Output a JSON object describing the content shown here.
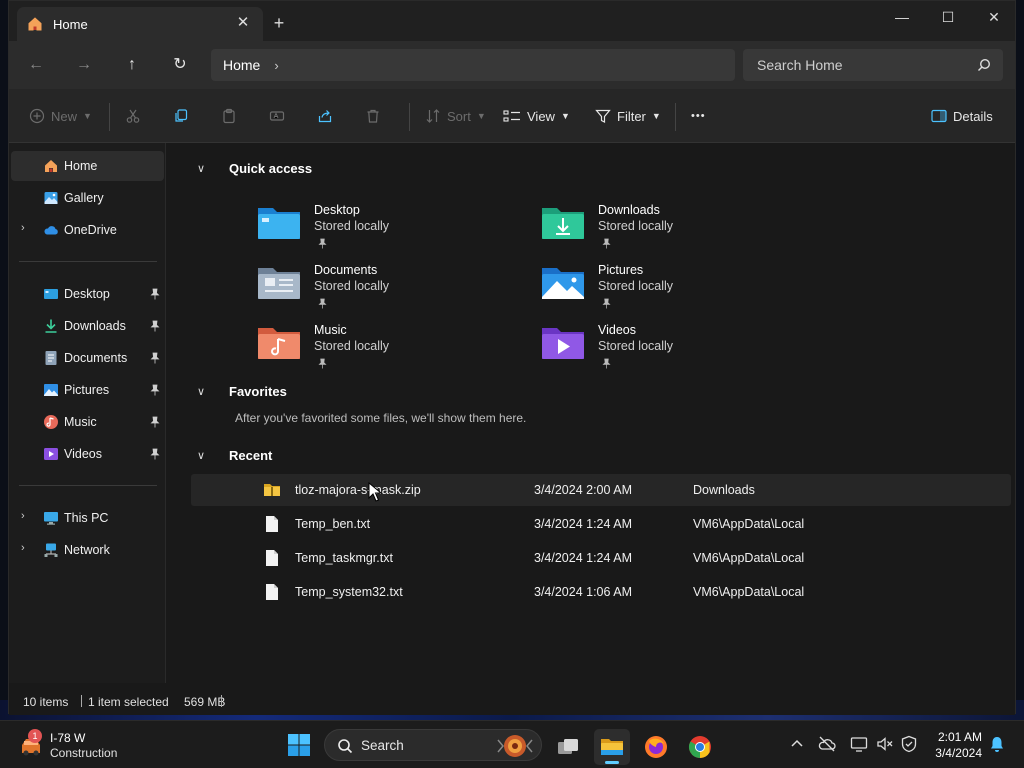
{
  "window": {
    "tab_label": "Home",
    "minimize": "—",
    "maximize": "☐",
    "close": "✕"
  },
  "address": {
    "path": "Home",
    "search_placeholder": "Search Home"
  },
  "toolbar": {
    "new": "New",
    "sort": "Sort",
    "view": "View",
    "filter": "Filter",
    "more": "•••",
    "details": "Details"
  },
  "sidebar": {
    "top": [
      {
        "label": "Home"
      },
      {
        "label": "Gallery"
      },
      {
        "label": "OneDrive"
      }
    ],
    "pinned": [
      {
        "label": "Desktop"
      },
      {
        "label": "Downloads"
      },
      {
        "label": "Documents"
      },
      {
        "label": "Pictures"
      },
      {
        "label": "Music"
      },
      {
        "label": "Videos"
      }
    ],
    "bottom": [
      {
        "label": "This PC"
      },
      {
        "label": "Network"
      }
    ]
  },
  "quick_access": {
    "title": "Quick access",
    "items": [
      {
        "name": "Desktop",
        "sub": "Stored locally"
      },
      {
        "name": "Downloads",
        "sub": "Stored locally"
      },
      {
        "name": "Documents",
        "sub": "Stored locally"
      },
      {
        "name": "Pictures",
        "sub": "Stored locally"
      },
      {
        "name": "Music",
        "sub": "Stored locally"
      },
      {
        "name": "Videos",
        "sub": "Stored locally"
      }
    ]
  },
  "favorites": {
    "title": "Favorites",
    "empty_message": "After you've favorited some files, we'll show them here."
  },
  "recent": {
    "title": "Recent",
    "items": [
      {
        "name": "tloz-majora-s-mask.zip",
        "date": "3/4/2024 2:00 AM",
        "location": "Downloads"
      },
      {
        "name": "Temp_ben.txt",
        "date": "3/4/2024 1:24 AM",
        "location": "VM6\\AppData\\Local"
      },
      {
        "name": "Temp_taskmgr.txt",
        "date": "3/4/2024 1:24 AM",
        "location": "VM6\\AppData\\Local"
      },
      {
        "name": "Temp_system32.txt",
        "date": "3/4/2024 1:06 AM",
        "location": "VM6\\AppData\\Local"
      }
    ]
  },
  "status": {
    "items": "10 items",
    "selected": "1 item selected",
    "size": "569 MB"
  },
  "taskbar": {
    "weather_badge": "1",
    "weather_line1": "I-78 W",
    "weather_line2": "Construction",
    "search_label": "Search",
    "time": "2:01 AM",
    "date": "3/4/2024"
  },
  "colors": {
    "accent": "#60cdff",
    "window_bg": "#191919",
    "taskbar_bg": "#1c1c1c"
  }
}
